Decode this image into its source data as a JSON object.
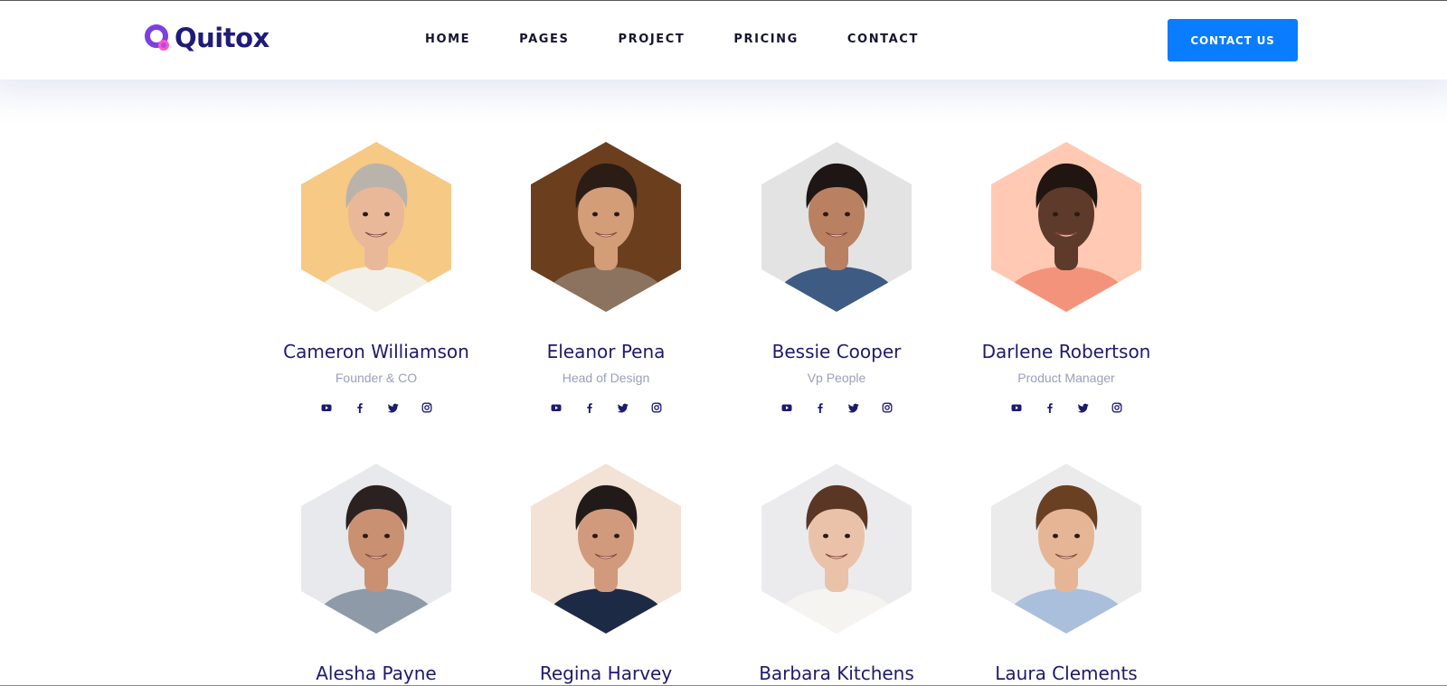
{
  "brand": {
    "name": "Quitox",
    "accent": "#7b3fe4",
    "brand_color": "#1f1b7a"
  },
  "nav": {
    "items": [
      "HOME",
      "PAGES",
      "PROJECT",
      "PRICING",
      "CONTACT"
    ]
  },
  "header": {
    "cta_label": "CONTACT US",
    "cta_color": "#0a7cff"
  },
  "team": {
    "members": [
      {
        "name": "Cameron Williamson",
        "role": "Founder & CO",
        "bg": "#f6c985",
        "skin": "#e8b898",
        "hair": "#b9b3ab",
        "shirt": "#f2efe9"
      },
      {
        "name": "Eleanor Pena",
        "role": "Head of Design",
        "bg": "#6b3f1e",
        "skin": "#d39d78",
        "hair": "#2b1d16",
        "shirt": "#8b735f"
      },
      {
        "name": "Bessie Cooper",
        "role": "Vp People",
        "bg": "#e3e3e4",
        "skin": "#b98062",
        "hair": "#1d1614",
        "shirt": "#3e5b83"
      },
      {
        "name": "Darlene Robertson",
        "role": "Product Manager",
        "bg": "#ffc9b3",
        "skin": "#5d3a2a",
        "hair": "#201510",
        "shirt": "#f4937c"
      },
      {
        "name": "Alesha Payne",
        "role": "",
        "bg": "#e8e9ec",
        "skin": "#c99072",
        "hair": "#2a2120",
        "shirt": "#8e9aa7"
      },
      {
        "name": "Regina Harvey",
        "role": "",
        "bg": "#f3e2d6",
        "skin": "#d29a7c",
        "hair": "#221a18",
        "shirt": "#1d2a45"
      },
      {
        "name": "Barbara Kitchens",
        "role": "",
        "bg": "#ebebee",
        "skin": "#eac2aa",
        "hair": "#5a3624",
        "shirt": "#f5f4f1"
      },
      {
        "name": "Laura Clements",
        "role": "",
        "bg": "#ebebec",
        "skin": "#e6b595",
        "hair": "#6a4022",
        "shirt": "#a9bfdc"
      }
    ],
    "social_icons": [
      "youtube-icon",
      "facebook-icon",
      "twitter-icon",
      "instagram-icon"
    ],
    "social_color": "#1d1a6e"
  }
}
